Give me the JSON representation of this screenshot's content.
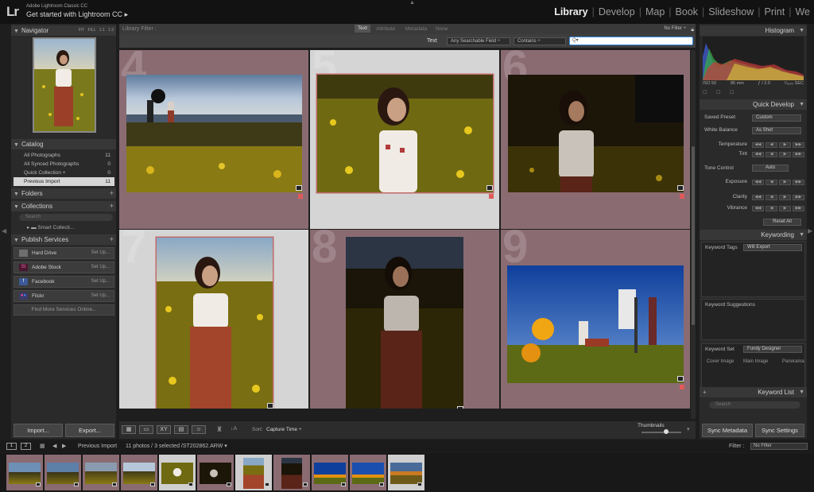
{
  "app": {
    "logo": "Lr",
    "brand_line1": "Adobe Lightroom Classic CC",
    "brand_line2": "Get started with Lightroom CC",
    "brand_arrow": "▸"
  },
  "modules": [
    "Library",
    "Develop",
    "Map",
    "Book",
    "Slideshow",
    "Print",
    "We"
  ],
  "active_module": "Library",
  "navigator": {
    "title": "Navigator",
    "zoom_options": "FIT  FILL  1:1  1:3"
  },
  "catalog": {
    "title": "Catalog",
    "items": [
      {
        "label": "All Photographs",
        "count": "11"
      },
      {
        "label": "All Synced Photographs",
        "count": "0"
      },
      {
        "label": "Quick Collection +",
        "count": "0"
      },
      {
        "label": "Previous Import",
        "count": "11"
      }
    ]
  },
  "folders": {
    "title": "Folders"
  },
  "collections": {
    "title": "Collections",
    "search_placeholder": "Search",
    "smart": "Smart Collecti..."
  },
  "publish": {
    "title": "Publish Services",
    "services": [
      {
        "name": "Hard Drive",
        "action": "Set Up...",
        "icon": "hard-drive-icon",
        "color": "#6e6e6e"
      },
      {
        "name": "Adobe Stock",
        "action": "Set Up...",
        "icon": "adobe-stock-icon",
        "color": "#4a1630"
      },
      {
        "name": "Facebook",
        "action": "Set Up...",
        "icon": "facebook-icon",
        "color": "#3b5998"
      },
      {
        "name": "Flickr",
        "action": "Set Up...",
        "icon": "flickr-icon",
        "color": "#3a3a6a"
      }
    ],
    "find_more": "Find More Services Online..."
  },
  "left_buttons": {
    "import": "Import...",
    "export": "Export..."
  },
  "filter_bar": {
    "label": "Library Filter :",
    "tabs": [
      "Text",
      "Attribute",
      "Metadata",
      "None"
    ],
    "active_tab": "Text",
    "no_filter": "No Filter ÷"
  },
  "text_filter": {
    "label": "Text",
    "field": "Any Searchable Field ÷",
    "rule": "Contains ÷",
    "search_placeholder": "Q▾"
  },
  "grid": {
    "cells": [
      {
        "number": "4",
        "selected": false
      },
      {
        "number": "5",
        "selected": true
      },
      {
        "number": "6",
        "selected": false
      },
      {
        "number": "7",
        "selected": true
      },
      {
        "number": "8",
        "selected": false
      },
      {
        "number": "9",
        "selected": false
      }
    ]
  },
  "toolbar": {
    "sort_label": "Sort:",
    "sort_value": "Capture Time ÷",
    "thumbnails_label": "Thumbnails"
  },
  "histogram": {
    "title": "Histogram",
    "iso": "ISO 50",
    "focal": "85 mm",
    "aperture": "ƒ / 2.0",
    "shutter": "¹⁄₁₆₀₀ SEC"
  },
  "quick_develop": {
    "title": "Quick Develop",
    "saved_preset_label": "Saved Preset",
    "saved_preset_value": "Custom",
    "white_balance_label": "White Balance",
    "white_balance_value": "As Shot",
    "temperature": "Temperature",
    "tint": "Tint",
    "tone_control": "Tone Control",
    "auto": "Auto",
    "exposure": "Exposure",
    "clarity": "Clarity",
    "vibrance": "Vibrance",
    "reset_all": "Reset All"
  },
  "keywording": {
    "title": "Keywording",
    "tags_label": "Keyword Tags",
    "tags_value": "Will Export",
    "suggestions": "Keyword Suggestions",
    "set_label": "Keyword Set",
    "set_value": "Fundy Designer",
    "set_items": [
      "Cover Image",
      "Main Image",
      "Panorama"
    ]
  },
  "keyword_list": {
    "title": "Keyword List",
    "search_placeholder": "Search"
  },
  "right_buttons": {
    "sync_metadata": "Sync Metadata",
    "sync_settings": "Sync Settings"
  },
  "filmstrip_header": {
    "page1": "1",
    "page2": "2",
    "source": "Previous Import",
    "info": "11 photos / 3 selected /ST202862.ARW ▾",
    "filter_label": "Filter :",
    "filter_value": "No Filter"
  },
  "colors": {
    "accent_selected": "#c06a6a",
    "cell_bg": "#8a6b72",
    "cell_selected_bg": "#d5d5d5"
  }
}
